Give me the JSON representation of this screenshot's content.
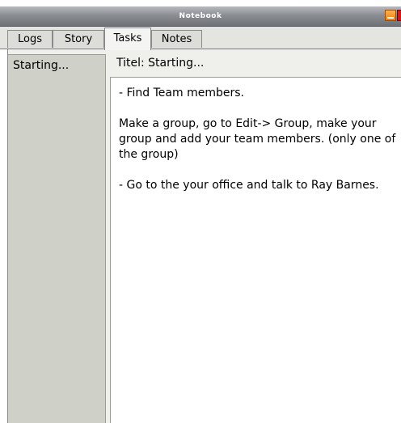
{
  "window": {
    "title": "Notebook"
  },
  "tabs": [
    {
      "label": "Logs"
    },
    {
      "label": "Story"
    },
    {
      "label": "Tasks"
    },
    {
      "label": "Notes"
    }
  ],
  "active_tab": "Tasks",
  "task_list": {
    "items": [
      {
        "label": "Starting..."
      }
    ]
  },
  "task_detail": {
    "title": "Titel: Starting...",
    "paragraphs": [
      "- Find Team members.",
      "Make a group, go to Edit-> Group, make your group and add your team members. (only one of the group)",
      "- Go to the your office and talk to Ray Barnes."
    ]
  },
  "colors": {
    "minimize_button": "#f07a10",
    "close_button": "#d81818"
  }
}
